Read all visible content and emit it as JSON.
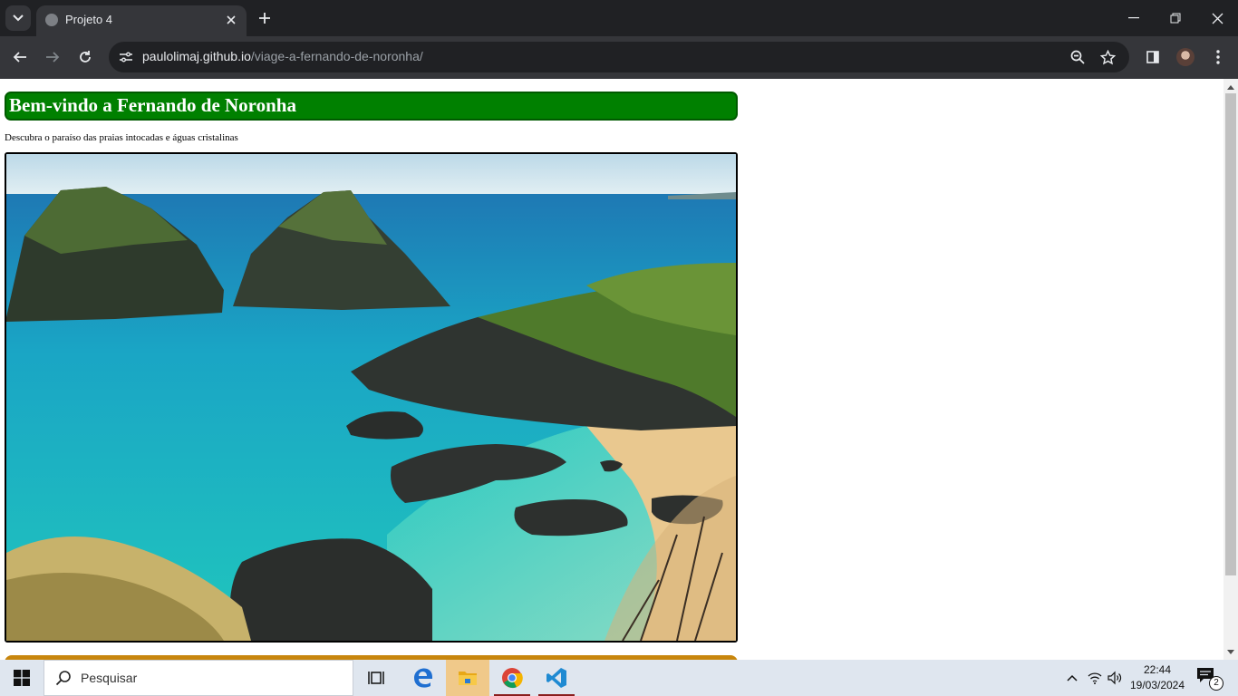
{
  "browser": {
    "tab_title": "Projeto 4",
    "url_host": "paulolimaj.github.io",
    "url_path": "/viage-a-fernando-de-noronha/",
    "icons": [
      "tab-search-icon",
      "close-icon",
      "plus-icon",
      "minimize-icon",
      "restore-icon",
      "close-window-icon",
      "back-icon",
      "forward-icon",
      "reload-icon",
      "site-settings-icon",
      "zoom-icon",
      "bookmark-star-icon",
      "side-panel-icon",
      "profile-avatar",
      "menu-dots-icon"
    ]
  },
  "page": {
    "heading": "Bem-vindo a Fernando de Noronha",
    "subtitle": "Descubra o paraíso das praias intocadas e águas cristalinas",
    "heading_color": "#008000",
    "next_section_color": "#c8860d"
  },
  "taskbar": {
    "search_placeholder": "Pesquisar",
    "time": "22:44",
    "date": "19/03/2024",
    "notification_count": "2",
    "apps": [
      "task-view-icon",
      "edge-icon",
      "file-explorer-icon",
      "chrome-icon",
      "vscode-icon"
    ]
  }
}
